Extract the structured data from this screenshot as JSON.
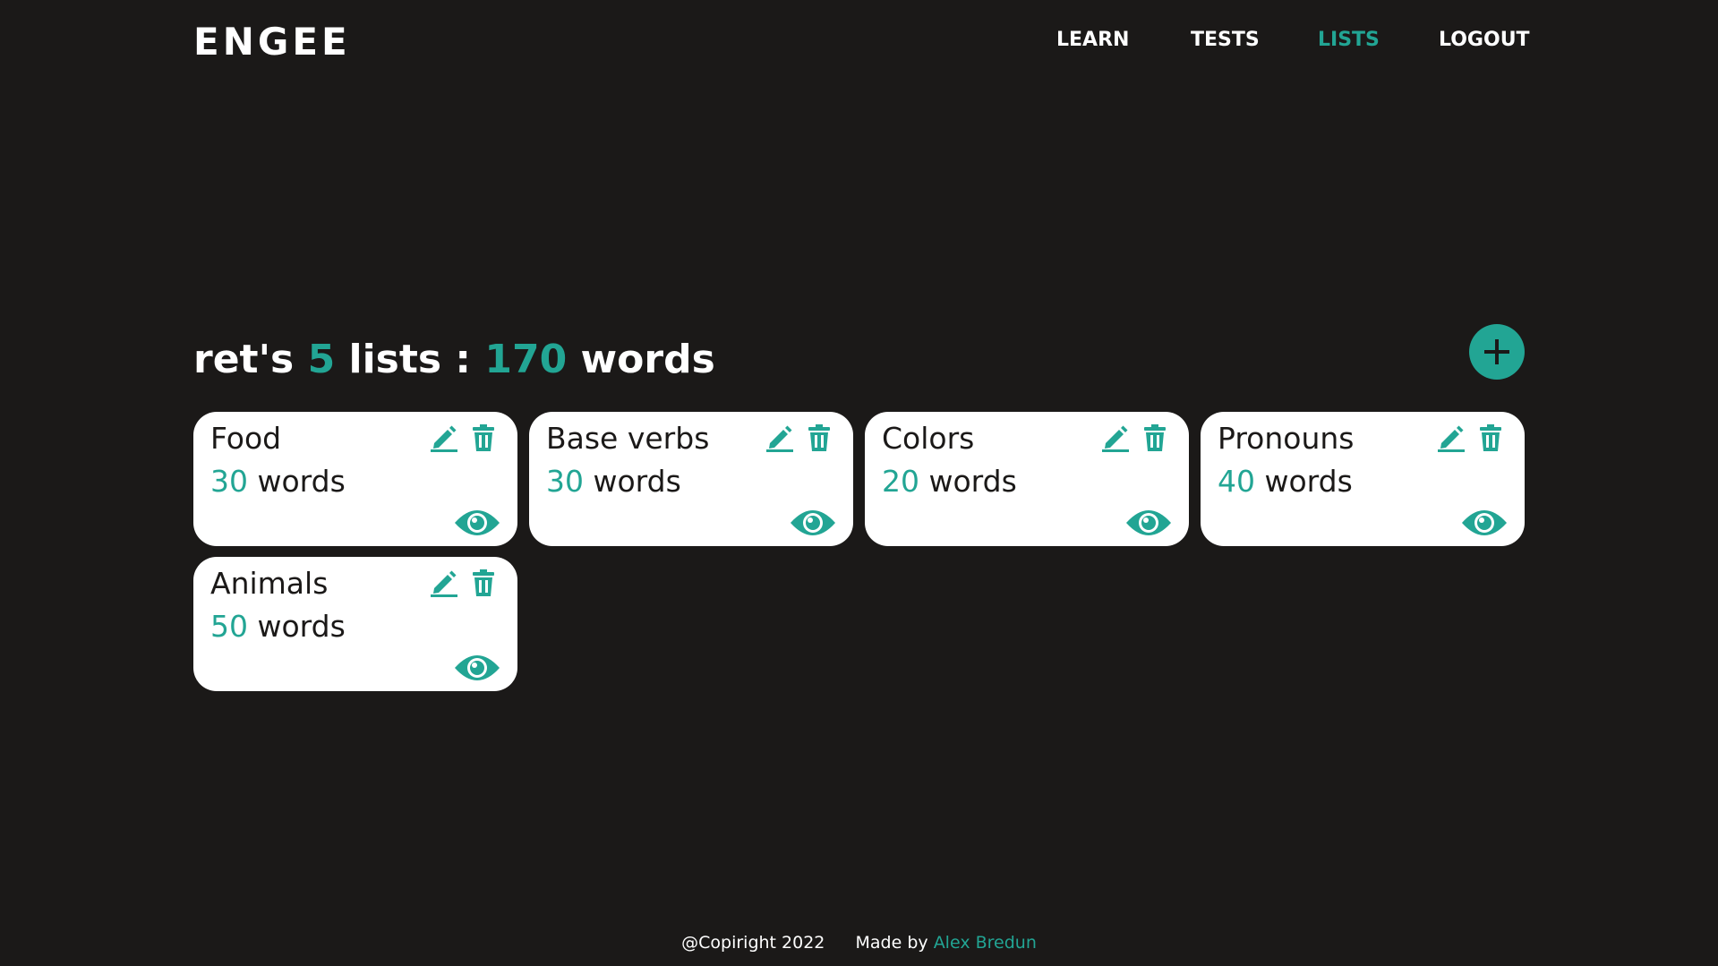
{
  "header": {
    "logo": "ENGEE",
    "nav": [
      {
        "label": "LEARN",
        "active": false
      },
      {
        "label": "TESTS",
        "active": false
      },
      {
        "label": "LISTS",
        "active": true
      },
      {
        "label": "LOGOUT",
        "active": false
      }
    ]
  },
  "summary": {
    "user_prefix": "ret's",
    "lists_count": "5",
    "lists_label": "lists :",
    "words_count": "170",
    "words_label": "words"
  },
  "add_button": {
    "icon": "plus-icon"
  },
  "lists": [
    {
      "title": "Food",
      "count": "30",
      "unit": "words"
    },
    {
      "title": "Base verbs",
      "count": "30",
      "unit": "words"
    },
    {
      "title": "Colors",
      "count": "20",
      "unit": "words"
    },
    {
      "title": "Pronouns",
      "count": "40",
      "unit": "words"
    },
    {
      "title": "Animals",
      "count": "50",
      "unit": "words"
    }
  ],
  "card_icons": {
    "edit": "pencil-icon",
    "delete": "trash-icon",
    "view": "eye-icon"
  },
  "footer": {
    "copyright": "@Copiright 2022",
    "made_by_label": "Made by",
    "author": "Alex Bredun"
  },
  "colors": {
    "accent": "#22a594",
    "background": "#1b1918",
    "card": "#ffffff"
  }
}
